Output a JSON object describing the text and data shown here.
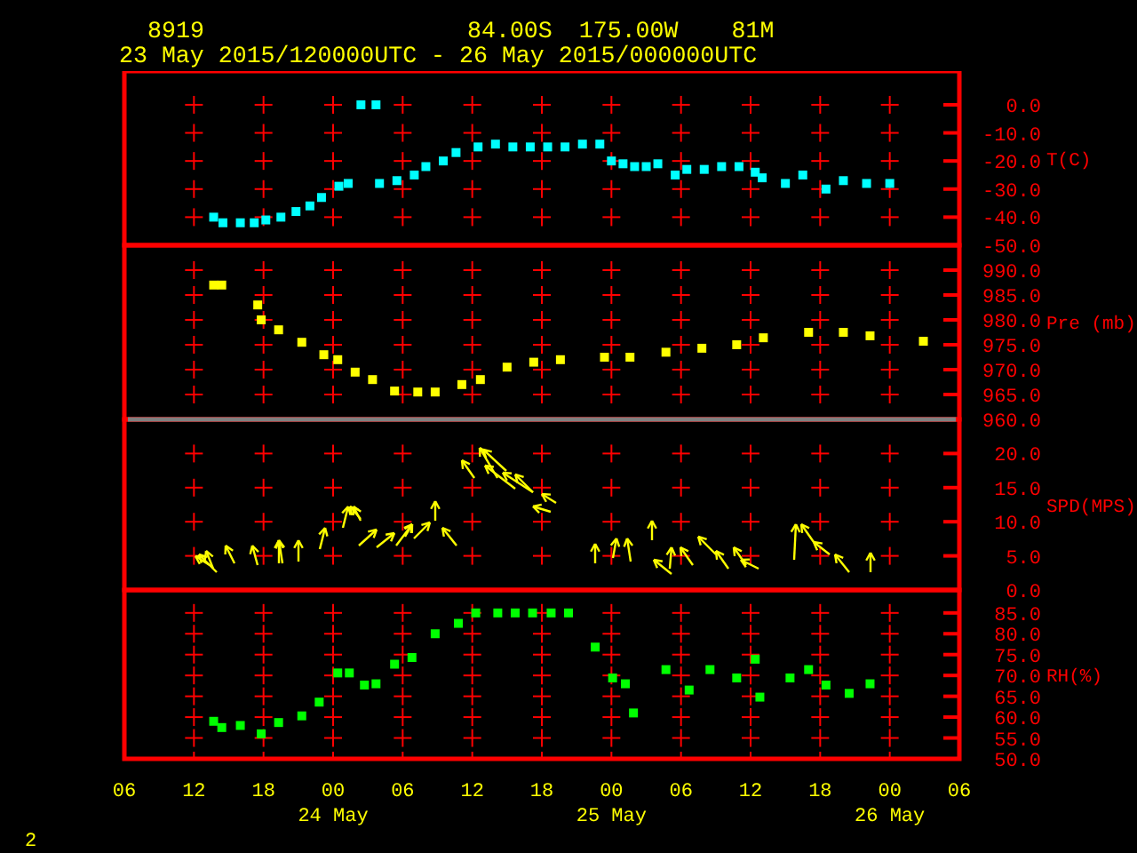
{
  "header": {
    "station": "8919",
    "latitude": "84.00S",
    "longitude": "175.00W",
    "elevation": "81M",
    "period": "23 May 2015/120000UTC - 26 May 2015/000000UTC"
  },
  "panels": [
    {
      "kind": "scatter",
      "chart_data": {
        "type": "scatter",
        "ylabel": "T(C)",
        "xlim": [
          6,
          78
        ],
        "ylim": [
          -50,
          12
        ],
        "yticks": [
          {
            "value": 0,
            "label": "0.0"
          },
          {
            "value": -10,
            "label": "-10.0"
          },
          {
            "value": -20,
            "label": "-20.0"
          },
          {
            "value": -30,
            "label": "-30.0"
          },
          {
            "value": -40,
            "label": "-40.0"
          },
          {
            "value": -50,
            "label": "-50.0"
          }
        ],
        "series": [
          {
            "color": "#00ffff",
            "x": [
              13.7,
              14.5,
              16,
              17.2,
              18.2,
              19.5,
              20.8,
              22,
              23,
              24.5,
              25.3,
              26.4,
              27.7,
              28,
              29.5,
              31,
              32,
              33.5,
              34.6,
              36.5,
              38,
              39.5,
              41,
              42.5,
              44,
              45.5,
              47,
              48,
              49,
              50,
              51,
              52,
              53.5,
              54.5,
              56,
              57.5,
              59,
              60.4,
              61,
              63,
              64.5,
              66.5,
              68,
              70,
              72
            ],
            "values": [
              -40,
              -42,
              -42,
              -42,
              -41,
              -40,
              -38,
              -36,
              -33,
              -29,
              -28,
              0,
              0,
              -28,
              -27,
              -25,
              -22,
              -20,
              -17,
              -15,
              -14,
              -15,
              -15,
              -15,
              -15,
              -14,
              -14,
              -20,
              -21,
              -22,
              -22,
              -21,
              -25,
              -23,
              -23,
              -22,
              -22,
              -24,
              -26,
              -28,
              -25,
              -30,
              -27,
              -28,
              -28
            ]
          }
        ]
      }
    },
    {
      "kind": "scatter",
      "chart_data": {
        "type": "scatter",
        "ylabel": "Pre (mb)",
        "xlim": [
          6,
          78
        ],
        "ylim": [
          960,
          995
        ],
        "yticks": [
          {
            "value": 990,
            "label": "990.0"
          },
          {
            "value": 985,
            "label": "985.0"
          },
          {
            "value": 980,
            "label": "980.0"
          },
          {
            "value": 975,
            "label": "975.0"
          },
          {
            "value": 970,
            "label": "970.0"
          },
          {
            "value": 965,
            "label": "965.0"
          },
          {
            "value": 960,
            "label": "960.0"
          }
        ],
        "series": [
          {
            "color": "#ffff00",
            "x": [
              13.7,
              14.4,
              17.5,
              17.8,
              19.3,
              21.3,
              23.2,
              24.4,
              25.9,
              27.4,
              29.3,
              31.3,
              32.8,
              35.1,
              36.7,
              39,
              41.3,
              43.6,
              47.4,
              49.6,
              52.7,
              55.8,
              58.8,
              61.1,
              65,
              68,
              70.3,
              74.9
            ],
            "values": [
              987,
              987,
              983,
              980,
              978,
              975.5,
              973,
              972,
              969.5,
              968,
              965.7,
              965.5,
              965.5,
              967,
              968,
              970.5,
              971.5,
              972,
              972.5,
              972.5,
              973.5,
              974.3,
              975,
              976.4,
              977.5,
              977.5,
              976.8,
              975.7
            ]
          }
        ]
      }
    },
    {
      "kind": "wind",
      "unit_label": "SPD(MPS)",
      "tick_labels": [
        "20.0",
        "15.0",
        "10.0",
        "5.0",
        "0.0"
      ]
    },
    {
      "kind": "scatter",
      "chart_data": {
        "type": "scatter",
        "ylabel": "RH(%)",
        "xlim": [
          6,
          78
        ],
        "ylim": [
          50,
          90.5
        ],
        "yticks": [
          {
            "value": 85,
            "label": "85.0"
          },
          {
            "value": 80,
            "label": "80.0"
          },
          {
            "value": 75,
            "label": "75.0"
          },
          {
            "value": 70,
            "label": "70.0"
          },
          {
            "value": 65,
            "label": "65.0"
          },
          {
            "value": 60,
            "label": "60.0"
          },
          {
            "value": 55,
            "label": "55.0"
          },
          {
            "value": 50,
            "label": "50.0"
          }
        ],
        "xticks": [
          {
            "value": 6,
            "label": "06"
          },
          {
            "value": 12,
            "label": "12"
          },
          {
            "value": 18,
            "label": "18"
          },
          {
            "value": 24,
            "label": "00"
          },
          {
            "value": 30,
            "label": "06"
          },
          {
            "value": 36,
            "label": "12"
          },
          {
            "value": 42,
            "label": "18"
          },
          {
            "value": 48,
            "label": "00"
          },
          {
            "value": 54,
            "label": "06"
          },
          {
            "value": 60,
            "label": "12"
          },
          {
            "value": 66,
            "label": "18"
          },
          {
            "value": 72,
            "label": "00"
          },
          {
            "value": 78,
            "label": "06"
          }
        ],
        "series": [
          {
            "color": "#00ff00",
            "x": [
              13.7,
              14.4,
              16,
              17.8,
              19.3,
              21.3,
              22.8,
              24.4,
              25.4,
              26.7,
              27.7,
              29.3,
              30.8,
              32.8,
              34.8,
              36.3,
              38.2,
              39.7,
              41.2,
              42.8,
              44.3,
              46.6,
              48.1,
              49.2,
              49.9,
              52.7,
              54.7,
              56.5,
              58.8,
              60.4,
              60.8,
              63.4,
              65,
              66.5,
              68.5,
              70.3
            ],
            "values": [
              59,
              57.5,
              58,
              56,
              58.7,
              60.3,
              63.6,
              70.6,
              70.6,
              67.7,
              68,
              72.7,
              74.3,
              80,
              82.5,
              85,
              85,
              85,
              85,
              85,
              85,
              76.8,
              69.4,
              68,
              61,
              71.4,
              66.5,
              71.4,
              69.4,
              73.9,
              64.8,
              69.4,
              71.4,
              67.7,
              65.7,
              68
            ]
          }
        ]
      }
    }
  ],
  "time_axis": {
    "dates": [
      "24 May",
      "25 May",
      "26 May"
    ]
  },
  "page_number": "2"
}
